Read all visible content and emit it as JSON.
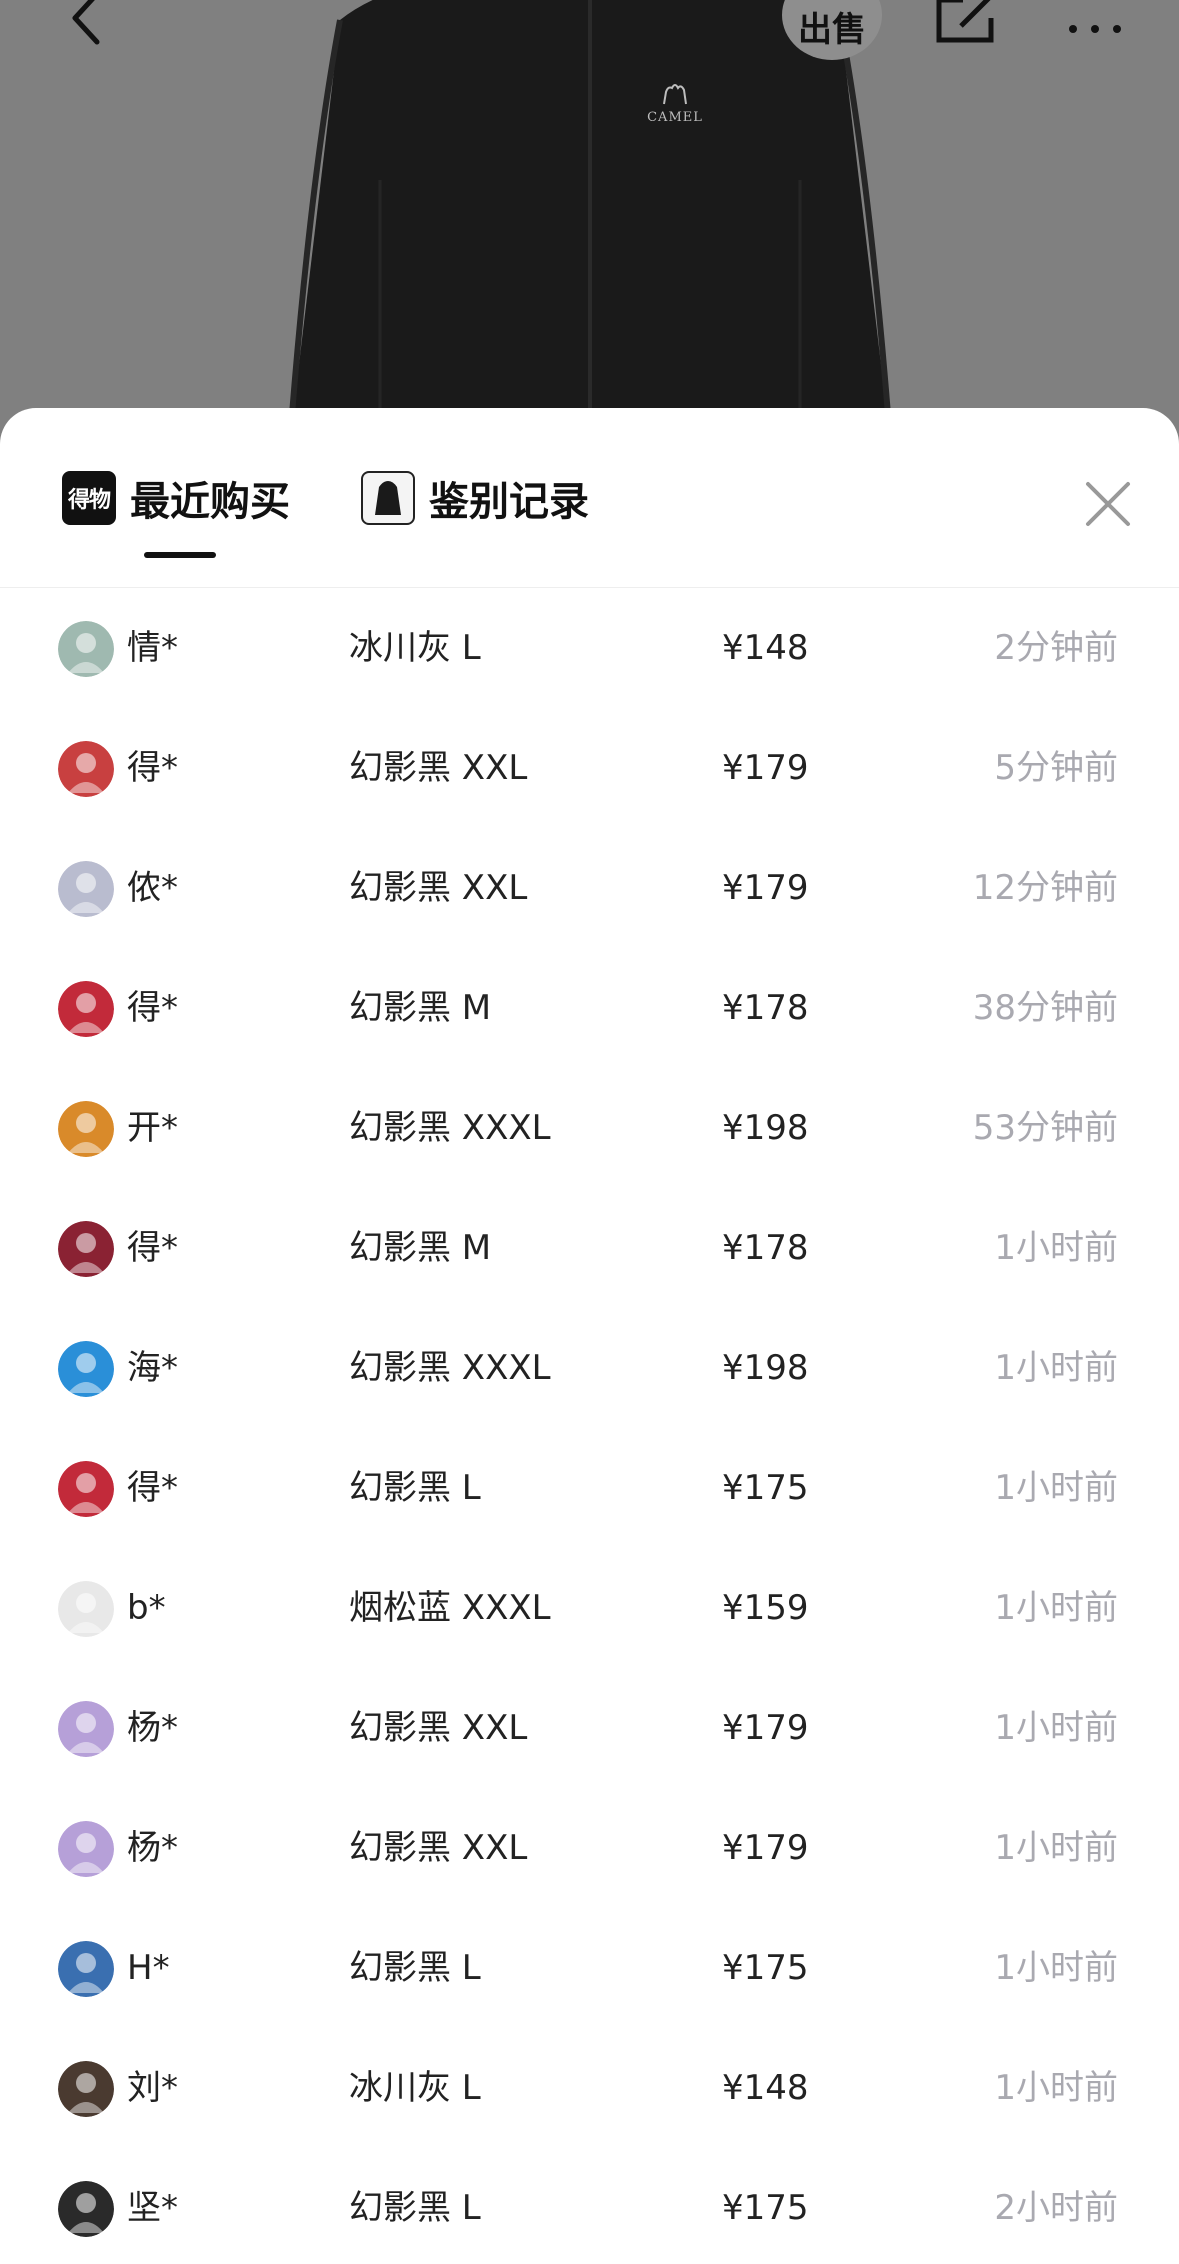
{
  "topbar": {
    "back_icon": "chevron-left-icon",
    "sell_label": "出售",
    "share_icon": "share-icon",
    "more_icon": "more-dots-icon"
  },
  "product": {
    "brand_logo_text": "CAMEL"
  },
  "tabs": [
    {
      "label": "最近购买",
      "logo_text": "得物",
      "active": true
    },
    {
      "label": "鉴别记录",
      "active": false
    }
  ],
  "colors": {
    "accent": "#111111",
    "muted_text": "#a9a9b0",
    "backdrop": "#808080"
  },
  "records": [
    {
      "buyer": "情*",
      "spec": "冰川灰 L",
      "price": "¥148",
      "time": "2分钟前",
      "avatar_color": "#9fb9b0"
    },
    {
      "buyer": "得*",
      "spec": "幻影黑 XXL",
      "price": "¥179",
      "time": "5分钟前",
      "avatar_color": "#c84040"
    },
    {
      "buyer": "侬*",
      "spec": "幻影黑 XXL",
      "price": "¥179",
      "time": "12分钟前",
      "avatar_color": "#b9bccf"
    },
    {
      "buyer": "得*",
      "spec": "幻影黑 M",
      "price": "¥178",
      "time": "38分钟前",
      "avatar_color": "#c22a3a"
    },
    {
      "buyer": "开*",
      "spec": "幻影黑 XXXL",
      "price": "¥198",
      "time": "53分钟前",
      "avatar_color": "#d98a2a"
    },
    {
      "buyer": "得*",
      "spec": "幻影黑 M",
      "price": "¥178",
      "time": "1小时前",
      "avatar_color": "#8a2233"
    },
    {
      "buyer": "海*",
      "spec": "幻影黑 XXXL",
      "price": "¥198",
      "time": "1小时前",
      "avatar_color": "#2a8fd8"
    },
    {
      "buyer": "得*",
      "spec": "幻影黑 L",
      "price": "¥175",
      "time": "1小时前",
      "avatar_color": "#c22a3a"
    },
    {
      "buyer": "b*",
      "spec": "烟松蓝 XXXL",
      "price": "¥159",
      "time": "1小时前",
      "avatar_color": "#e8e8e8"
    },
    {
      "buyer": "杨*",
      "spec": "幻影黑 XXL",
      "price": "¥179",
      "time": "1小时前",
      "avatar_color": "#b6a0d8"
    },
    {
      "buyer": "杨*",
      "spec": "幻影黑 XXL",
      "price": "¥179",
      "time": "1小时前",
      "avatar_color": "#b6a0d8"
    },
    {
      "buyer": "H*",
      "spec": "幻影黑 L",
      "price": "¥175",
      "time": "1小时前",
      "avatar_color": "#3a6fb0"
    },
    {
      "buyer": "刘*",
      "spec": "冰川灰 L",
      "price": "¥148",
      "time": "1小时前",
      "avatar_color": "#4a3a30"
    },
    {
      "buyer": "坚*",
      "spec": "幻影黑 L",
      "price": "¥175",
      "time": "2小时前",
      "avatar_color": "#2a2a2a"
    }
  ]
}
